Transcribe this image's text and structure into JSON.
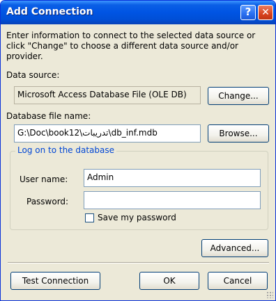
{
  "window": {
    "title": "Add Connection",
    "help_glyph": "?",
    "close_glyph": "✕"
  },
  "intro": {
    "line1": "Enter information to connect to the selected data source or",
    "line2": "click \"Change\" to choose a different data source and/or",
    "line3": "provider."
  },
  "data_source": {
    "label": "Data source:",
    "value": "Microsoft Access Database File (OLE DB)",
    "change_button": "Change..."
  },
  "database_file": {
    "label": "Database file name:",
    "value": "G:\\Doc\\book12\\تدريبات\\db_inf.mdb",
    "browse_button": "Browse..."
  },
  "logon": {
    "group_title": "Log on to the database",
    "username_label": "User name:",
    "username_value": "Admin",
    "password_label": "Password:",
    "password_value": "",
    "save_password_label": "Save my password",
    "save_password_checked": false
  },
  "buttons": {
    "advanced": "Advanced...",
    "test_connection": "Test Connection",
    "ok": "OK",
    "cancel": "Cancel"
  },
  "colors": {
    "titlebar": "#0054e3",
    "dialog_bg": "#ece9d8",
    "group_title": "#0046d5",
    "close_button": "#d8431f"
  }
}
